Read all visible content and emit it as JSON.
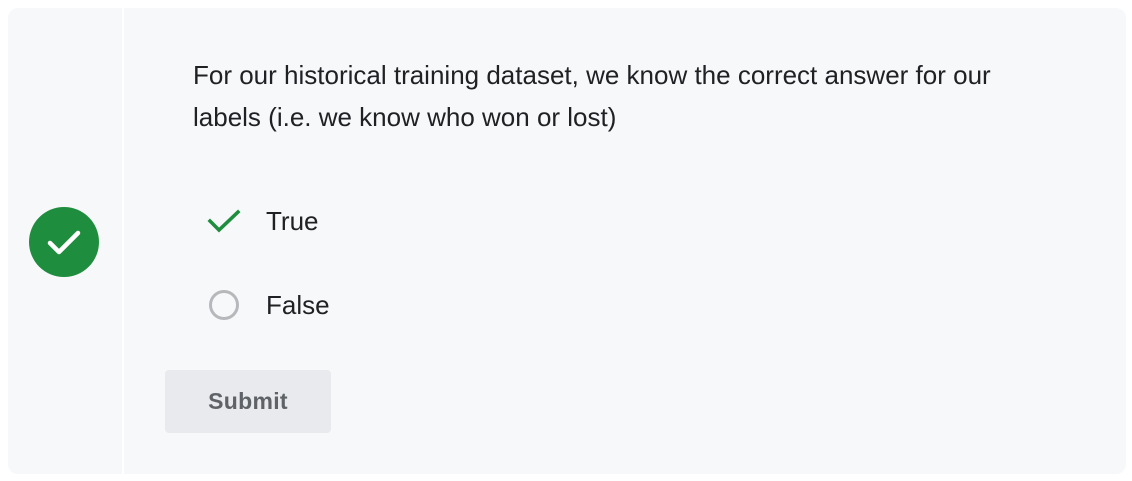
{
  "question": {
    "text": "For our historical training dataset, we know the correct answer for our labels (i.e. we know who won or lost)"
  },
  "status": {
    "state": "correct",
    "icon": "check-circle-icon",
    "color": "#1e8e3e"
  },
  "options": [
    {
      "label": "True",
      "selected": true,
      "marker_icon": "check-icon",
      "marker_color": "#1e8e3e"
    },
    {
      "label": "False",
      "selected": false,
      "marker_icon": "radio-unchecked-icon",
      "marker_color": "#b6b8bc"
    }
  ],
  "submit": {
    "label": "Submit",
    "enabled": false
  }
}
